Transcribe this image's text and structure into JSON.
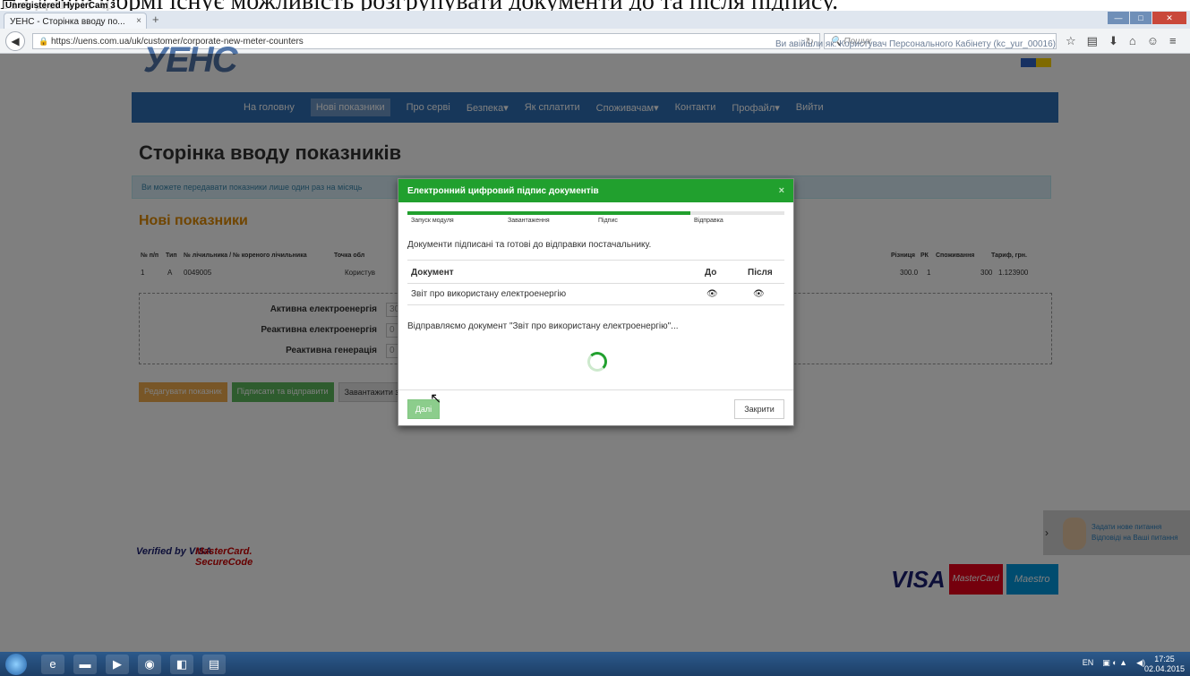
{
  "caption": {
    "text": "На даній формі існує можливість розгрупувати документи до та після підпису.",
    "recorder": "Unregistered HyperCam 3"
  },
  "browser": {
    "tab_title": "УЕНС - Сторінка вводу по...",
    "tab_close": "×",
    "new_tab": "+",
    "url": "https://uens.com.ua/uk/customer/corporate-new-meter-counters",
    "search_placeholder": "Пошук",
    "win_minimize": "—",
    "win_maximize": "□",
    "win_close": "✕"
  },
  "site": {
    "logo": "УЕНС",
    "logged_in": "Ви авійшли як: Користувач Персонального Кабінету (kc_yur_00016)",
    "nav": [
      "На головну",
      "Нові показники",
      "Про серві",
      "Безпека▾",
      "Як сплатити",
      "Споживачам▾",
      "Контакти",
      "Профайл▾",
      "Вийти"
    ],
    "page_title": "Сторінка вводу показників",
    "info": "Ви можете передавати показники лише один раз на місяць",
    "section_title": "Нові показники",
    "table_headers": [
      "№ п/п",
      "Тип",
      "№ лічильника / № кореного лічильника",
      "Точка обл",
      "Різниця",
      "РК",
      "Споживання",
      "Тариф, грн."
    ],
    "table_row": [
      "1",
      "А",
      "0049005",
      "Користув",
      "300.0",
      "1",
      "300",
      "1.123900"
    ],
    "readings": [
      {
        "label": "Активна електроенергія",
        "value": "300"
      },
      {
        "label": "Реактивна електроенергія",
        "value": "0"
      },
      {
        "label": "Реактивна генерація",
        "value": "0"
      }
    ],
    "buttons": {
      "edit": "Редагувати показник",
      "sign": "Підписати та відправити",
      "pdf": "Завантажити звіт в форматі PDF"
    },
    "footer": {
      "verified": "Verified by VISA",
      "mastercard": "MasterCard. SecureCode",
      "visa": "VISA",
      "card_mc": "MasterCard",
      "card_maestro": "Maestro"
    },
    "help": {
      "line1": "Задати нове питання",
      "line2": "Відповіді на Ваші питання"
    }
  },
  "modal": {
    "title": "Електронний цифровий підпис документів",
    "close": "×",
    "progress": 0.75,
    "steps": [
      "Запуск модуля",
      "Завантаження",
      "Підпис",
      "Відправка"
    ],
    "message": "Документи підписані та готові до відправки постачальнику.",
    "table": {
      "col_doc": "Документ",
      "col_before": "До",
      "col_after": "Після",
      "rows": [
        {
          "doc": "Звіт про використану електроенергію",
          "before": "👁",
          "after": "👁"
        }
      ]
    },
    "status": "Відправляємо документ \"Звіт про використану електроенергію\"...",
    "next_button": "Далі",
    "close_button": "Закрити"
  },
  "taskbar": {
    "lang": "EN",
    "time": "17:25",
    "date": "02.04.2015"
  }
}
